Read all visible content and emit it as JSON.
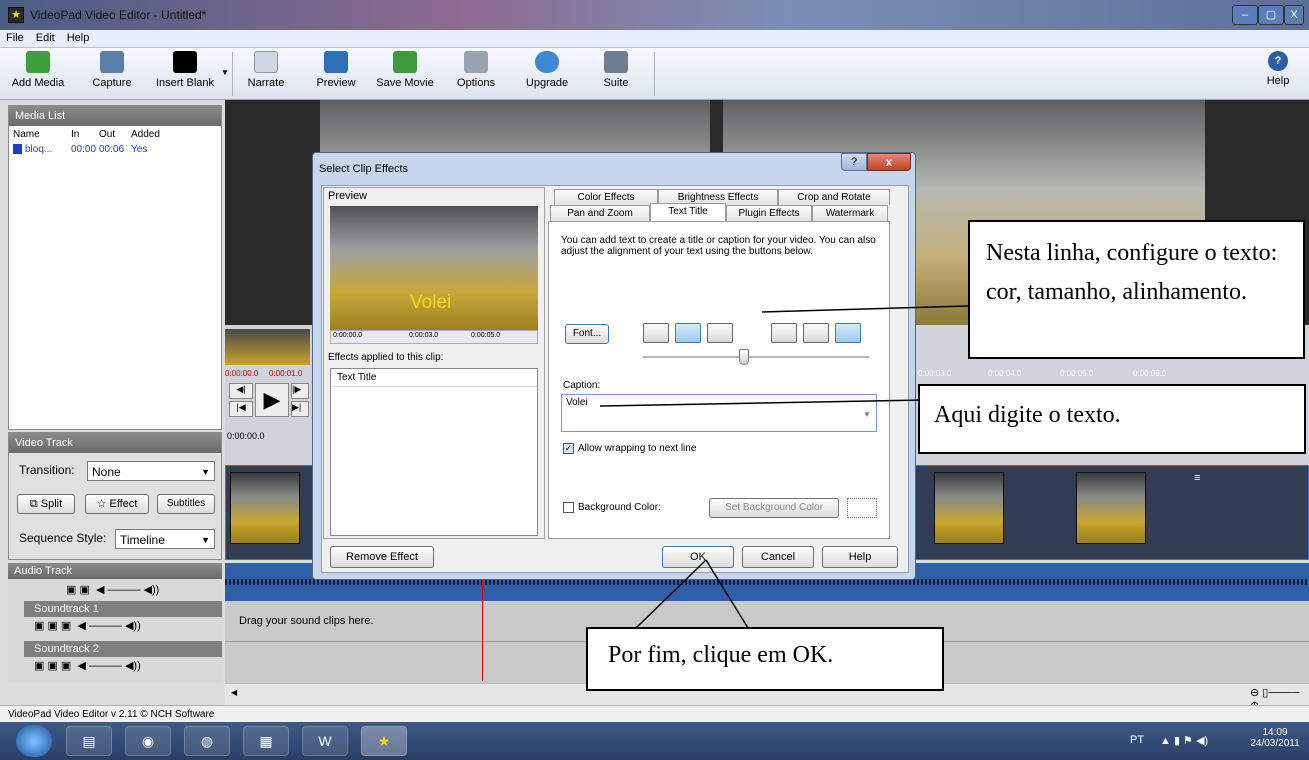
{
  "window": {
    "title": "VideoPad Video Editor - Untitled*",
    "min": "–",
    "max": "▢",
    "close": "X"
  },
  "menu": [
    "File",
    "Edit",
    "Help"
  ],
  "toolbar": [
    {
      "label": "Add Media",
      "icon": "add-media-icon",
      "color": "#3aa03a"
    },
    {
      "label": "Capture",
      "icon": "camera-icon",
      "color": "#5a7fa8"
    },
    {
      "label": "Insert Blank",
      "icon": "blank-frame-icon",
      "color": "#000000"
    },
    {
      "label": "Narrate",
      "icon": "narrate-icon",
      "color": "#cfd8e2"
    },
    {
      "label": "Preview",
      "icon": "preview-icon",
      "color": "#2f6fba"
    },
    {
      "label": "Save Movie",
      "icon": "save-movie-icon",
      "color": "#3c9a3c"
    },
    {
      "label": "Options",
      "icon": "options-icon",
      "color": "#9aa4b0"
    },
    {
      "label": "Upgrade",
      "icon": "upgrade-icon",
      "color": "#3f88d6"
    },
    {
      "label": "Suite",
      "icon": "suite-icon",
      "color": "#6f7e90"
    }
  ],
  "help": "Help",
  "media_list": {
    "title": "Media List",
    "columns": [
      "Name",
      "In",
      "Out",
      "Added"
    ],
    "rows": [
      {
        "name": "bloq...",
        "in": "00:00",
        "out": "00:06",
        "added": "Yes"
      }
    ]
  },
  "video_track": {
    "title": "Video Track",
    "transition_label": "Transition:",
    "transition_value": "None",
    "split": "Split",
    "effect": "Effect",
    "subtitles": "Subtitles",
    "sequence_label": "Sequence Style:",
    "sequence_value": "Timeline"
  },
  "timecodes": {
    "t1": "0:00:00.0",
    "t2": "0:00:01.0",
    "t3": "0:00:00.0",
    "right": [
      "0:00:03.0",
      "0:00:04.0",
      "0:00:05.0",
      "0:00:06.0"
    ]
  },
  "audio": {
    "title": "Audio Track",
    "soundtrack1": "Soundtrack 1",
    "soundtrack2": "Soundtrack 2",
    "drag_hint": "Drag your sound clips here."
  },
  "status": "VideoPad Video Editor v 2.11 © NCH Software",
  "taskbar": {
    "lang": "PT",
    "time": "14:09",
    "date": "24/03/2011"
  },
  "dialog": {
    "title": "Select Clip Effects",
    "help_btn": "?",
    "close_btn": "x",
    "preview_label": "Preview",
    "preview_caption": "Volei",
    "preview_times": [
      "0:00:00.0",
      "0:00:03.0",
      "0:00:05.0"
    ],
    "effects_label": "Effects applied to this clip:",
    "effects": [
      "Text Title"
    ],
    "remove": "Remove Effect",
    "tabs_row1": [
      "Color Effects",
      "Brightness Effects",
      "Crop and Rotate"
    ],
    "tabs_row2": [
      "Pan and Zoom",
      "Text Title",
      "Plugin Effects",
      "Watermark"
    ],
    "description": "You can add text to create a title or caption for your video. You can also adjust the alignment of your text using the buttons below.",
    "font": "Font...",
    "caption_label": "Caption:",
    "caption_value": "Volei",
    "wrap_label": "Allow wrapping to next line",
    "bg_label": "Background Color:",
    "set_bg": "Set Background Color",
    "ok": "OK",
    "cancel": "Cancel",
    "help": "Help"
  },
  "callouts": {
    "c1": "Nesta linha, configure o texto: cor, tamanho, alinhamento.",
    "c2": "Aqui digite o texto.",
    "c3": "Por fim, clique em OK."
  }
}
